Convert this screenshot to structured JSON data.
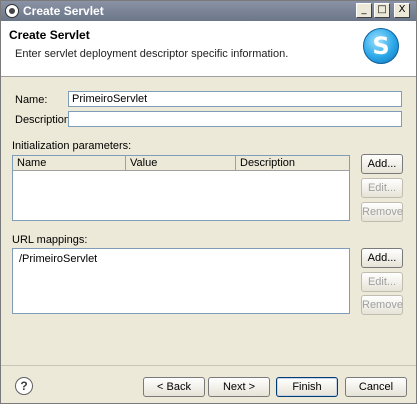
{
  "window": {
    "title": "Create Servlet",
    "min_glyph": "_",
    "max_glyph": "□",
    "close_glyph": "X"
  },
  "banner": {
    "title": "Create Servlet",
    "description": "Enter servlet deployment descriptor specific information.",
    "logo_letter": "S"
  },
  "form": {
    "name_label": "Name:",
    "name_value": "PrimeiroServlet",
    "description_label": "Description:",
    "description_value": ""
  },
  "init_params": {
    "label": "Initialization parameters:",
    "columns": [
      "Name",
      "Value",
      "Description"
    ],
    "rows": [],
    "add_label": "Add...",
    "edit_label": "Edit...",
    "remove_label": "Remove"
  },
  "url_mappings": {
    "label": "URL mappings:",
    "items": [
      "/PrimeiroServlet"
    ],
    "add_label": "Add...",
    "edit_label": "Edit...",
    "remove_label": "Remove"
  },
  "footer": {
    "help_glyph": "?",
    "back_label": "< Back",
    "next_label": "Next >",
    "finish_label": "Finish",
    "cancel_label": "Cancel"
  }
}
